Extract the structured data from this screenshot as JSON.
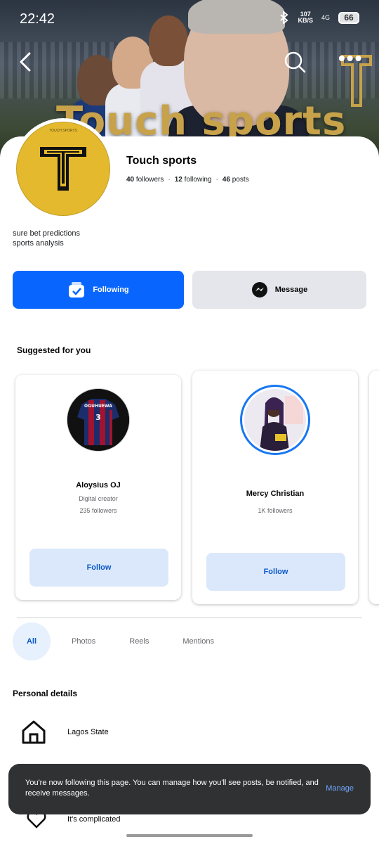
{
  "status_bar": {
    "time": "22:42",
    "net_speed": "107",
    "net_unit": "KB/S",
    "signal": "4G",
    "battery": "66"
  },
  "cover": {
    "text": "Touch sports",
    "bluetooth_icon": "bluetooth-icon"
  },
  "nav": {
    "back_icon": "arrow-left-icon",
    "search_icon": "search-icon",
    "more_icon": "more-dots-icon"
  },
  "profile": {
    "avatar_brand": "TOUCH SPORTS",
    "name": "Touch sports",
    "followers_count": "40",
    "followers_label": "followers",
    "following_count": "12",
    "following_label": "following",
    "posts_count": "46",
    "posts_label": "posts",
    "bio_line1": "sure bet predictions",
    "bio_line2": "sports analysis"
  },
  "actions": {
    "following_label": "Following",
    "message_label": "Message",
    "accent": "#0866ff"
  },
  "suggested": {
    "title": "Suggested for you",
    "cards": [
      {
        "name": "Aloysius OJ",
        "subtitle": "Digital creator",
        "followers": "235 followers",
        "button": "Follow",
        "jersey_name": "OGUHUEWA",
        "jersey_number": "3"
      },
      {
        "name": "Mercy Christian",
        "followers": "1K followers",
        "button": "Follow"
      }
    ]
  },
  "tabs": [
    {
      "label": "All"
    },
    {
      "label": "Photos"
    },
    {
      "label": "Reels"
    },
    {
      "label": "Mentions"
    }
  ],
  "personal_details": {
    "title": "Personal details",
    "items": [
      {
        "icon": "home-icon",
        "label": "Lagos State"
      },
      {
        "icon": "heart-icon",
        "label": "It's complicated"
      }
    ]
  },
  "snackbar": {
    "message": "You're now following this page. You can manage how you'll see posts, be notified, and receive messages.",
    "action": "Manage"
  }
}
